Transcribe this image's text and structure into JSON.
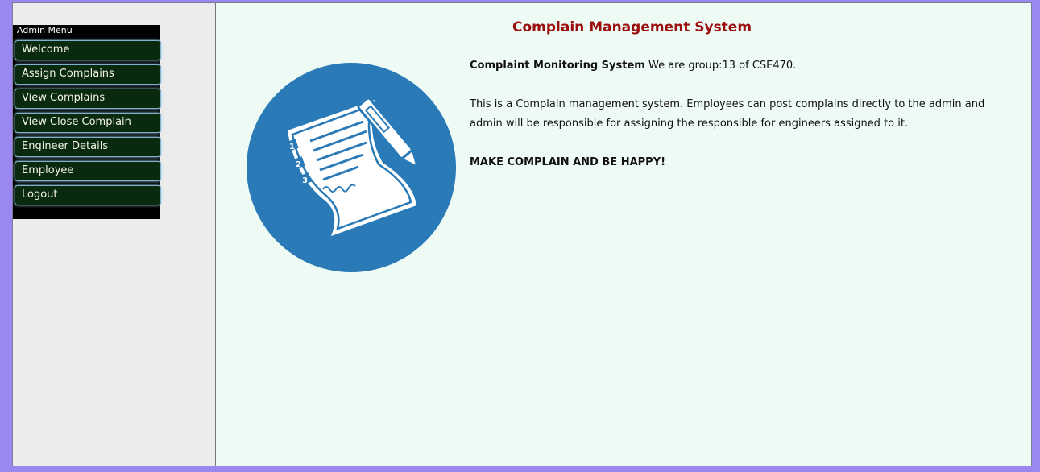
{
  "sidebar": {
    "menu_title": "Admin Menu",
    "items": [
      {
        "label": "Welcome"
      },
      {
        "label": "Assign Complains"
      },
      {
        "label": "View Complains"
      },
      {
        "label": "View Close Complain"
      },
      {
        "label": "Engineer Details"
      },
      {
        "label": "Employee"
      },
      {
        "label": "Logout"
      }
    ]
  },
  "main": {
    "title": "Complain Management System",
    "intro_bold": "Complaint Monitoring System",
    "intro_rest": " We are group:13 of CSE470.",
    "description": "This is a Complain management system. Employees can post complains directly to the admin and admin will be responsible for assigning the responsible for engineers assigned to it.",
    "slogan": "MAKE COMPLAIN AND BE HAPPY!",
    "logo_icon": "checklist-document-pen-icon"
  },
  "colors": {
    "page_background": "#9b87f0",
    "sidebar_background": "#ececec",
    "main_background": "#eefaf4",
    "menu_item_background": "#0a2a0d",
    "title_color": "#9b0d0d",
    "logo_circle": "#2a7ab8"
  }
}
